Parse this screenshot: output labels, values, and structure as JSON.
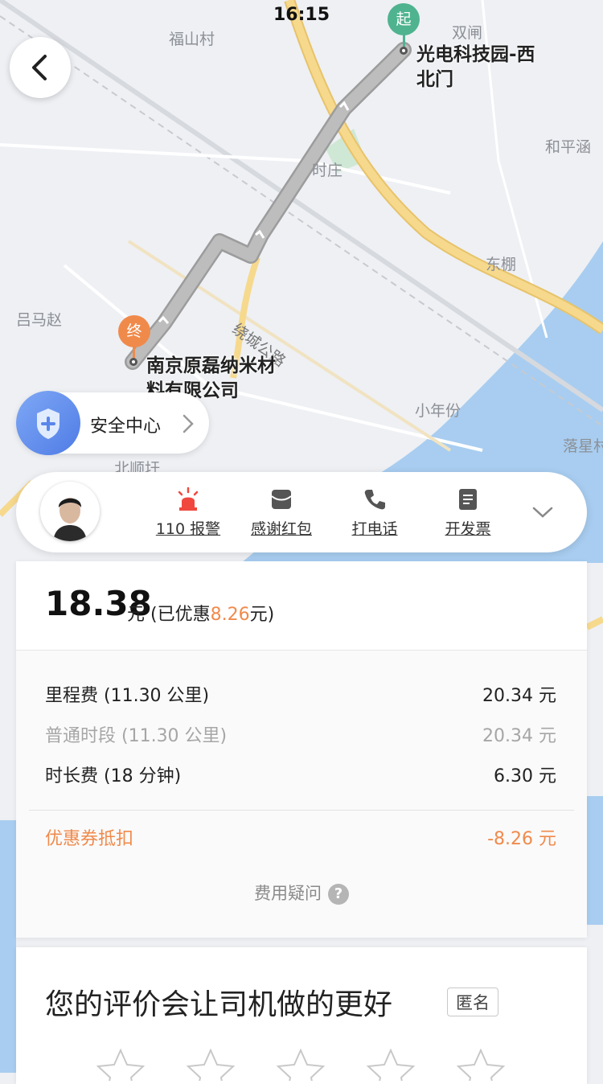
{
  "status_bar": {
    "time": "16:15"
  },
  "map": {
    "labels": [
      "福山村",
      "双闸",
      "和平涵",
      "时庄",
      "东棚",
      "吕马赵",
      "绕城公路",
      "小年份",
      "落星村",
      "北顺圩"
    ],
    "start": {
      "pin_text": "起",
      "name": "光电科技园-西北门",
      "line1": "光电科技园-西",
      "line2": "北门",
      "color": "#4fb38f"
    },
    "end": {
      "pin_text": "终",
      "name": "南京原磊纳米材料有限公司",
      "line1": "南京原磊纳米材",
      "line2": "料有限公司",
      "color": "#f08a4b"
    }
  },
  "safety_center": {
    "label": "安全中心",
    "icon": "shield-plus-icon"
  },
  "actions": [
    {
      "label": "110 报警",
      "icon": "siren-icon"
    },
    {
      "label": "感谢红包",
      "icon": "red-envelope-icon"
    },
    {
      "label": "打电话",
      "icon": "phone-icon"
    },
    {
      "label": "开发票",
      "icon": "invoice-icon"
    }
  ],
  "fare": {
    "total": "18.38",
    "unit": "元",
    "discount_prefix": "(已优惠",
    "discount_value": "8.26",
    "discount_suffix": "元)",
    "rows": [
      {
        "label": "里程费 (11.30 公里)",
        "value": "20.34 元"
      },
      {
        "label": "普通时段 (11.30 公里)",
        "value": "20.34 元"
      },
      {
        "label": "时长费 (18 分钟)",
        "value": "6.30 元"
      }
    ],
    "coupon": {
      "label": "优惠券抵扣",
      "value": "-8.26 元"
    },
    "help_label": "费用疑问",
    "help_icon_text": "?"
  },
  "rating": {
    "title": "您的评价会让司机做的更好",
    "anonymous_label": "匿名",
    "stars_max": 5
  },
  "colors": {
    "accent_orange": "#f08a4b",
    "route_gray": "#b9b9b9",
    "road_yellow": "#f6d98d",
    "water_blue": "#a8cdf0"
  }
}
